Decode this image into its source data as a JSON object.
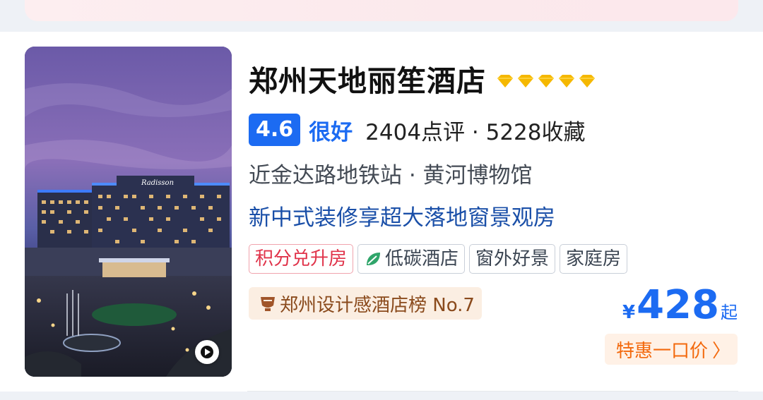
{
  "hotel": {
    "name": "郑州天地丽笙酒店",
    "diamond_count": 5,
    "score": "4.6",
    "score_word": "很好",
    "reviews_favorites": "2404点评 · 5228收藏",
    "location": "近金达路地铁站 · 黄河博物馆",
    "tagline": "新中式装修享超大落地窗景观房",
    "tags": [
      {
        "label": "积分兑升房",
        "style": "red"
      },
      {
        "label": "低碳酒店",
        "style": "gray",
        "icon": "leaf-icon"
      },
      {
        "label": "窗外好景",
        "style": "gray"
      },
      {
        "label": "家庭房",
        "style": "gray"
      }
    ],
    "rank": "郑州设计感酒店榜 No.7",
    "currency": "¥",
    "price": "428",
    "price_suffix": "起",
    "deal_label": "特惠一口价",
    "deal_chevron": "〉",
    "photo_signage": "Radisson"
  },
  "colors": {
    "accent_blue": "#1c6bf2",
    "tag_red": "#e0334a",
    "deal_orange": "#f3690d",
    "diamond_gold": "#f5b800",
    "rank_brown": "#8a4a1c"
  }
}
